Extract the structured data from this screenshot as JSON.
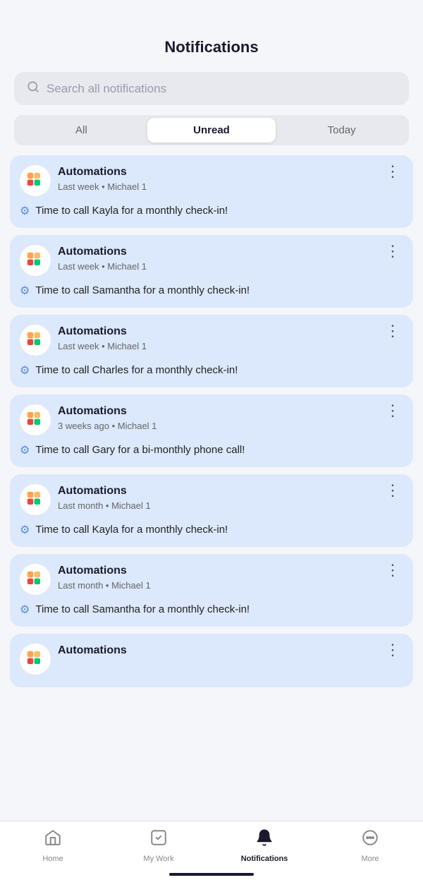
{
  "header": {
    "title": "Notifications"
  },
  "search": {
    "placeholder": "Search all notifications"
  },
  "filters": {
    "tabs": [
      {
        "label": "All",
        "active": false
      },
      {
        "label": "Unread",
        "active": true
      },
      {
        "label": "Today",
        "active": false
      }
    ]
  },
  "notifications": [
    {
      "title": "Automations",
      "subtitle": "Last week • Michael 1",
      "message": "Time to call Kayla for a monthly check-in!"
    },
    {
      "title": "Automations",
      "subtitle": "Last week • Michael 1",
      "message": "Time to call Samantha for a monthly check-in!"
    },
    {
      "title": "Automations",
      "subtitle": "Last week • Michael 1",
      "message": "Time to call Charles for a monthly check-in!"
    },
    {
      "title": "Automations",
      "subtitle": "3 weeks ago • Michael 1",
      "message": "Time to call Gary for a bi-monthly phone call!"
    },
    {
      "title": "Automations",
      "subtitle": "Last month • Michael 1",
      "message": "Time to call Kayla for a monthly check-in!"
    },
    {
      "title": "Automations",
      "subtitle": "Last month • Michael 1",
      "message": "Time to call Samantha for a monthly check-in!"
    },
    {
      "title": "Automations",
      "subtitle": "",
      "message": ""
    }
  ],
  "bottomNav": {
    "items": [
      {
        "label": "Home",
        "icon": "home-icon",
        "active": false
      },
      {
        "label": "My Work",
        "icon": "mywork-icon",
        "active": false
      },
      {
        "label": "Notifications",
        "icon": "notif-icon",
        "active": true
      },
      {
        "label": "More",
        "icon": "more-icon",
        "active": false
      }
    ]
  }
}
